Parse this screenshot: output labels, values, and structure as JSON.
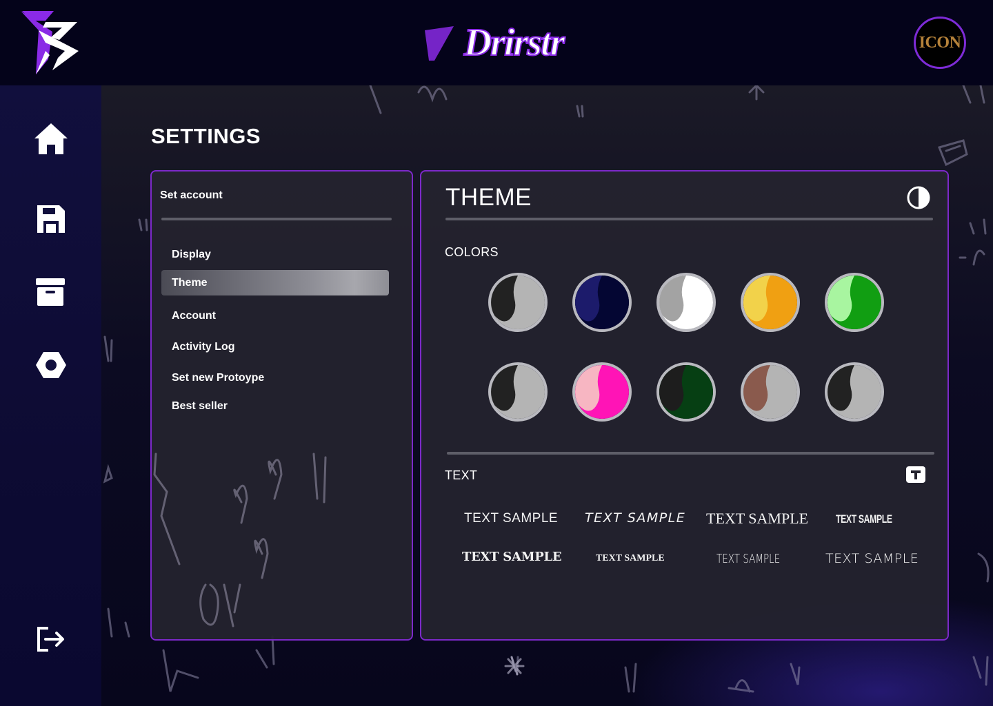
{
  "header": {
    "brand_wordmark": "Drirstr",
    "user_badge_text": "ICON"
  },
  "sidebar": {
    "items": [
      {
        "icon": "home-icon"
      },
      {
        "icon": "save-icon"
      },
      {
        "icon": "archive-icon"
      },
      {
        "icon": "settings-icon"
      },
      {
        "icon": "logout-icon"
      }
    ]
  },
  "page": {
    "title": "SETTINGS"
  },
  "settings_menu": {
    "heading": "Set account",
    "items": [
      "Display",
      "Theme",
      "Account",
      "Activity Log",
      "Set new Protoype",
      "Best seller"
    ],
    "active": "Theme"
  },
  "theme_panel": {
    "title": "THEME",
    "colors_label": "COLORS",
    "text_label": "TEXT",
    "swatches": [
      {
        "name": "black-grey",
        "primary": "#222222",
        "secondary": "#b4b4b4"
      },
      {
        "name": "navy",
        "primary": "#1c1b6b",
        "secondary": "#040633"
      },
      {
        "name": "grey-white",
        "primary": "#a3a3a3",
        "secondary": "#ffffff"
      },
      {
        "name": "yellow-orange",
        "primary": "#f2d24a",
        "secondary": "#f0a012"
      },
      {
        "name": "mint-green",
        "primary": "#a8f5a0",
        "secondary": "#119e12"
      },
      {
        "name": "black-grey-2",
        "primary": "#222222",
        "secondary": "#b4b4b4"
      },
      {
        "name": "pink-magenta",
        "primary": "#f7b6c2",
        "secondary": "#ff14b6"
      },
      {
        "name": "black-darkgreen",
        "primary": "#1d1d1d",
        "secondary": "#063f13"
      },
      {
        "name": "brown-grey",
        "primary": "#8a5a4d",
        "secondary": "#b4b4b4"
      },
      {
        "name": "black-grey-3",
        "primary": "#222222",
        "secondary": "#b4b4b4"
      }
    ],
    "text_samples": [
      "TEXT SAMPLE",
      "TEXT SAMPLE",
      "TEXT SAMPLE",
      "TEXT SAMPLE",
      "TEXT SAMPLE",
      "TEXT SAMPLE",
      "TEXT SAMPLE",
      "TEXT SAMPLE"
    ]
  },
  "colors": {
    "accent": "#7c29c9",
    "header_bg": "#04031a",
    "sidebar_bg": "#110f3d",
    "panel_bg": "#24232e"
  }
}
